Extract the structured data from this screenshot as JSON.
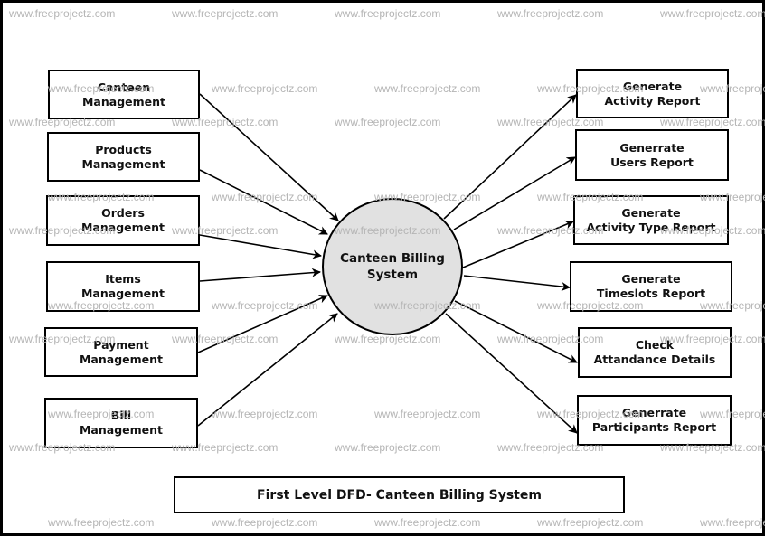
{
  "diagram": {
    "type": "First Level Data Flow Diagram",
    "central_process": {
      "line1": "Canteen Billing",
      "line2": "System"
    },
    "inputs": [
      {
        "line1": "Canteen",
        "line2": "Management"
      },
      {
        "line1": "Products",
        "line2": "Management"
      },
      {
        "line1": "Orders",
        "line2": "Management"
      },
      {
        "line1": "Items",
        "line2": "Management"
      },
      {
        "line1": "Payment",
        "line2": "Management"
      },
      {
        "line1": "Bill",
        "line2": "Management"
      }
    ],
    "outputs": [
      {
        "line1": "Generate",
        "line2": "Activity Report"
      },
      {
        "line1": "Generrate",
        "line2": "Users Report"
      },
      {
        "line1": "Generate",
        "line2": "Activity Type Report"
      },
      {
        "line1": "Generate",
        "line2": "Timeslots Report"
      },
      {
        "line1": "Check",
        "line2": "Attandance Details"
      },
      {
        "line1": "Generrate",
        "line2": "Participants Report"
      }
    ],
    "title": "First Level DFD- Canteen Billing System",
    "watermark": "www.freeprojectz.com",
    "colors": {
      "process_fill": "#e1e1e1",
      "stroke": "#000000",
      "watermark": "#b5b5b5"
    }
  }
}
